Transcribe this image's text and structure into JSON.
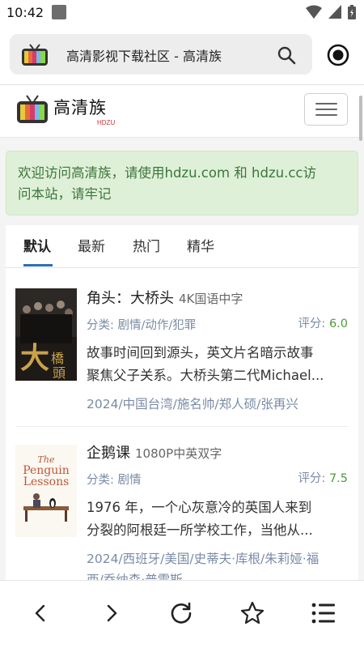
{
  "status_bar": {
    "time": "10:42"
  },
  "browser": {
    "url_title": "高清影视下载社区 - 高清族"
  },
  "site": {
    "logo_text": "高清族",
    "logo_sub": "HDZU"
  },
  "alert": {
    "line1": "欢迎访问高清族，请使用hdzu.com 和 hdzu.cc访",
    "line2": "问本站，请牢记"
  },
  "tabs": [
    {
      "label": "默认"
    },
    {
      "label": "最新"
    },
    {
      "label": "热门"
    },
    {
      "label": "精华"
    }
  ],
  "items": [
    {
      "title": "角头：大桥头",
      "quality": "4K国语中字",
      "category": "分类: 剧情/动作/犯罪",
      "score_label": "评分:",
      "score": "6.0",
      "desc_line1": "故事时间回到源头，英文片名暗示故事",
      "desc_line2": "聚焦父子关系。大桥头第二代Michael...",
      "tags": "2024/中国台湾/施名帅/郑人硕/张再兴"
    },
    {
      "title": "企鹅课",
      "quality": "1080P中英双字",
      "category": "分类: 剧情",
      "score_label": "评分:",
      "score": "7.5",
      "desc_line1": "1976 年，一个心灰意冷的英国人来到",
      "desc_line2": "分裂的阿根廷一所学校工作，当他从...",
      "tags_line1": "2024/西班牙/美国/史蒂夫·库根/朱莉娅·福",
      "tags_line2": "西/乔纳森·普雷斯"
    }
  ],
  "colors": {
    "alert_bg": "#dff0d8",
    "alert_text": "#3c763d",
    "tab_underline": "#2f6fb5",
    "score": "#4e9a3a",
    "meta_text": "#7a8ba6"
  }
}
